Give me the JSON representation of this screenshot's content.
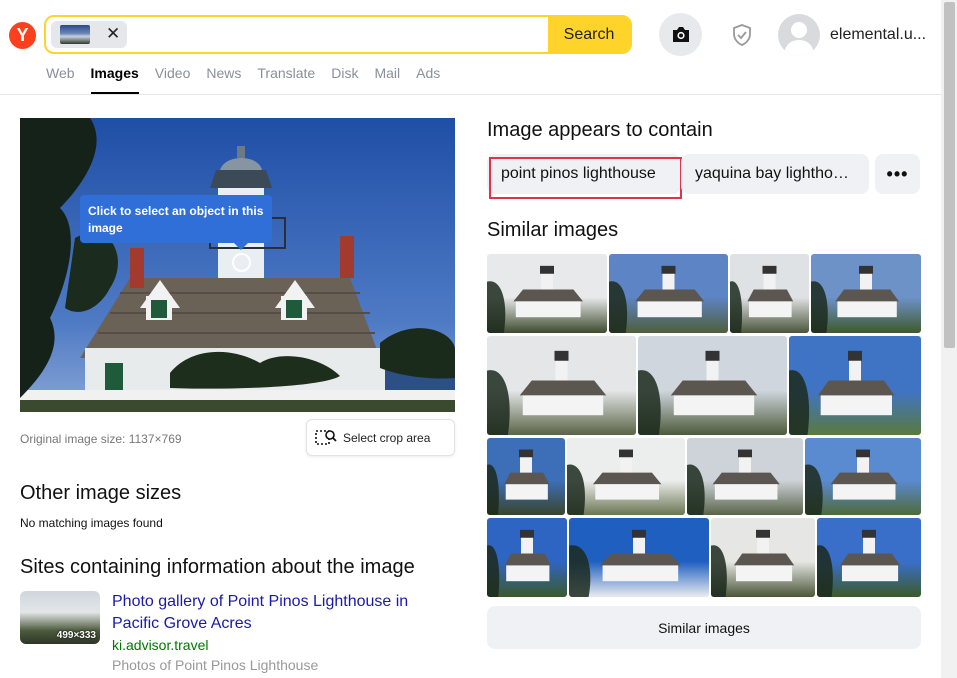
{
  "header": {
    "logo_letter": "Y",
    "search_button": "Search",
    "chip_close": "✕",
    "username": "elemental.u..."
  },
  "tabs": [
    {
      "label": "Web",
      "active": false
    },
    {
      "label": "Images",
      "active": true
    },
    {
      "label": "Video",
      "active": false
    },
    {
      "label": "News",
      "active": false
    },
    {
      "label": "Translate",
      "active": false
    },
    {
      "label": "Disk",
      "active": false
    },
    {
      "label": "Mail",
      "active": false
    },
    {
      "label": "Ads",
      "active": false
    }
  ],
  "main_image": {
    "tooltip": "Click to select an object in this image",
    "original_size": "Original image size: 1137×769",
    "crop_button": "Select crop area"
  },
  "other_sizes": {
    "heading": "Other image sizes",
    "message": "No matching images found"
  },
  "sites": {
    "heading": "Sites containing information about the image",
    "items": [
      {
        "title": "Photo gallery of Point Pinos Lighthouse in Pacific Grove Acres",
        "domain": "ki.advisor.travel",
        "description": "Photos of Point Pinos Lighthouse",
        "thumb_size": "499×333"
      }
    ]
  },
  "contains": {
    "heading": "Image appears to contain",
    "chips": [
      "point pinos lighthouse",
      "yaquina bay lighthouse"
    ],
    "more": "•••"
  },
  "similar": {
    "heading": "Similar images",
    "button": "Similar images",
    "thumbs": [
      {
        "sky": "#e7e9ea",
        "ground": "#3e4a2e"
      },
      {
        "sky": "#5d84c4",
        "ground": "#4f5e3a"
      },
      {
        "sky": "#dfe2e4",
        "ground": "#4a553a"
      },
      {
        "sky": "#6d92c8",
        "ground": "#3f5a2c"
      },
      {
        "sky": "#e4e6e8",
        "ground": "#5a6446"
      },
      {
        "sky": "#cfd6de",
        "ground": "#4d5a3a"
      },
      {
        "sky": "#3f74c5",
        "ground": "#5a7a3e"
      },
      {
        "sky": "#3d6fb8",
        "ground": "#39452c"
      },
      {
        "sky": "#eceeee",
        "ground": "#6b7652"
      },
      {
        "sky": "#cdd3d8",
        "ground": "#59634a"
      },
      {
        "sky": "#5a8ad0",
        "ground": "#4f6a3a"
      },
      {
        "sky": "#2f65c2",
        "ground": "#3b5a2c"
      },
      {
        "sky": "#1f5fc0",
        "ground": "#e9ecef"
      },
      {
        "sky": "#e6e6e4",
        "ground": "#4b5637"
      },
      {
        "sky": "#3a6fc9",
        "ground": "#3c5a2a"
      }
    ]
  }
}
